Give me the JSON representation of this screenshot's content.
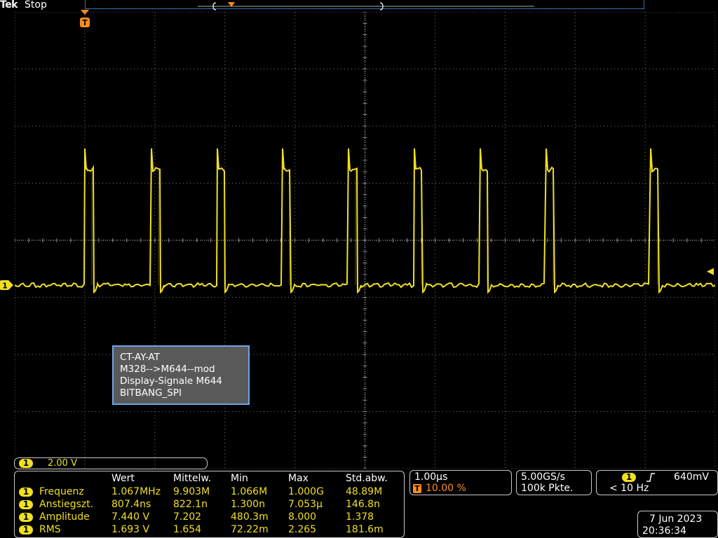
{
  "status": {
    "brand": "Tek",
    "run_state": "Stop"
  },
  "channel": {
    "label": "1",
    "scale": "2.00 V",
    "color": "#f0e020"
  },
  "trigger_marker": "T",
  "note": {
    "lines": [
      "CT-AY-AT",
      "M328-->M644--mod",
      "Display-Signale M644",
      "BITBANG_SPI"
    ]
  },
  "measurements": {
    "headers": [
      "Wert",
      "Mittelw.",
      "Min",
      "Max",
      "Std.abw."
    ],
    "rows": [
      {
        "channel": "1",
        "name": "Frequenz",
        "values": [
          "1.067MHz",
          "9.903M",
          "1.066M",
          "1.000G",
          "48.89M"
        ]
      },
      {
        "channel": "1",
        "name": "Anstiegszt.",
        "values": [
          "807.4ns",
          "822.1n",
          "1.300n",
          "7.053µ",
          "146.8n"
        ]
      },
      {
        "channel": "1",
        "name": "Amplitude",
        "values": [
          "7.440 V",
          "7.202",
          "480.3m",
          "8.000",
          "1.378"
        ]
      },
      {
        "channel": "1",
        "name": "RMS",
        "values": [
          "1.693 V",
          "1.654",
          "72.22m",
          "2.265",
          "181.6m"
        ]
      }
    ]
  },
  "timebase": {
    "scale": "1.00µs",
    "trigger_badge": "T",
    "trigger_pos": "10.00 %"
  },
  "sampling": {
    "rate": "5.00GS/s",
    "points": "100k Pkte."
  },
  "trigger": {
    "channel": "1",
    "edge_icon": "rising-edge-icon",
    "level": "640mV",
    "freq": "< 10 Hz"
  },
  "datetime": {
    "date": "7 Jun 2023",
    "time": "20:36:34"
  }
}
